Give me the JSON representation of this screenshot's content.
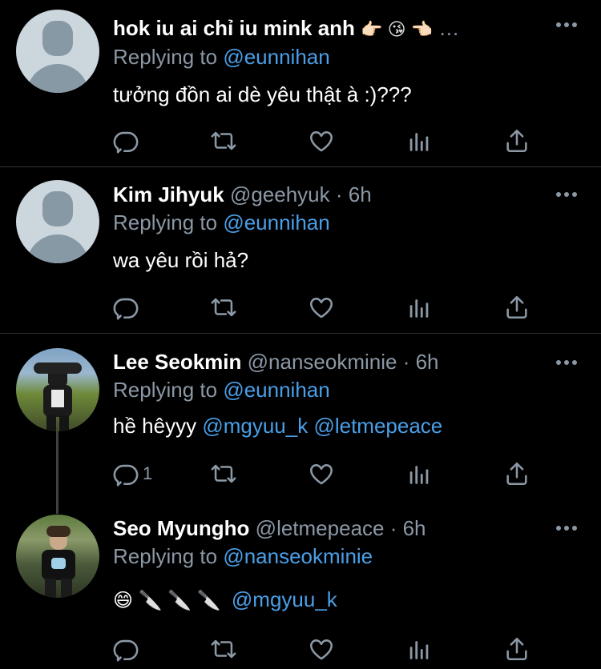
{
  "tweets": [
    {
      "name": "hok iu ai chỉ iu mink anh",
      "name_emojis": "👉🏻 😘 👈🏻",
      "handle": "…",
      "replying_label": "Replying to",
      "replying_to": "@eunnihan",
      "text": "tưởng đồn ai dè yêu thật à :)???",
      "avatar": "default-avatar"
    },
    {
      "name": "Kim Jihyuk",
      "handle": "@geehyuk · 6h",
      "replying_label": "Replying to",
      "replying_to": "@eunnihan",
      "text": "wa yêu rồi hả?",
      "avatar": "default-avatar"
    },
    {
      "name": "Lee Seokmin",
      "handle": "@nanseokminie · 6h",
      "replying_label": "Replying to",
      "replying_to": "@eunnihan",
      "text_prefix": "hề hêyyy",
      "mention1": "@mgyuu_k",
      "mention2": "@letmepeace",
      "reply_count": "1",
      "avatar": "photo-avatar"
    },
    {
      "name": "Seo Myungho",
      "handle": "@letmepeace · 6h",
      "replying_label": "Replying to",
      "replying_to": "@nanseokminie",
      "emoji_text": "😄 🔪 🔪 🔪",
      "mention1": "@mgyuu_k",
      "avatar": "photo-avatar"
    }
  ],
  "icons": {
    "reply": "reply-icon",
    "retweet": "retweet-icon",
    "like": "heart-icon",
    "analytics": "analytics-icon",
    "share": "share-icon",
    "more": "more-icon"
  },
  "colors": {
    "background": "#000000",
    "name": "#ffffff",
    "secondary": "#8b98a5",
    "mention": "#4a9fe8",
    "divider": "#2f3336"
  }
}
